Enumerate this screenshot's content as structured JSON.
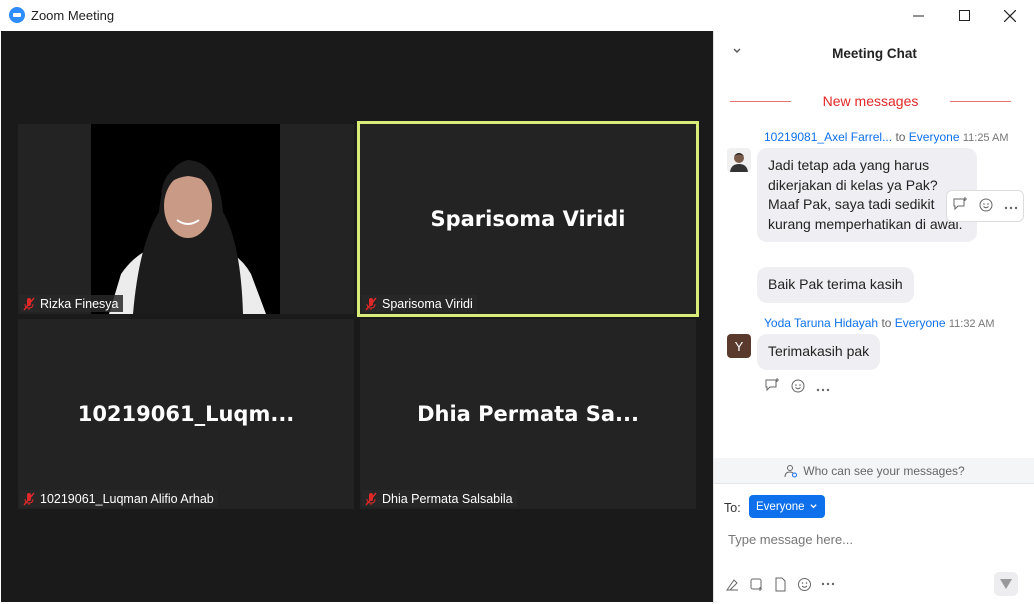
{
  "window": {
    "title": "Zoom Meeting"
  },
  "participants": [
    {
      "display_name": "Rizka Finesya",
      "name_tag": "Rizka Finesya"
    },
    {
      "display_name": "Sparisoma Viridi",
      "name_tag": "Sparisoma Viridi"
    },
    {
      "display_name": "10219061_Luqm...",
      "name_tag": "10219061_Luqman Alifio Arhab"
    },
    {
      "display_name": "Dhia Permata Sa...",
      "name_tag": "Dhia Permata Salsabila"
    }
  ],
  "chat": {
    "title": "Meeting Chat",
    "new_messages": "New messages",
    "messages": [
      {
        "sender": "10219081_Axel Farrel...",
        "to": "to",
        "recipient": "Everyone",
        "time": "11:25 AM",
        "text": "Jadi tetap ada yang harus dikerjakan di kelas ya Pak? Maaf Pak, saya tadi sedikit kurang memperhatikan di awal.",
        "followup": "Baik Pak terima kasih"
      },
      {
        "sender": "Yoda Taruna Hidayah",
        "to": "to",
        "recipient": "Everyone",
        "time": "11:32 AM",
        "avatar_letter": "Y",
        "text": "Terimakasih pak"
      }
    ],
    "visibility_hint": "Who can see your messages?",
    "compose": {
      "to_label": "To:",
      "recipient": "Everyone",
      "placeholder": "Type message here..."
    }
  },
  "colors": {
    "accent": "#0e71eb",
    "active_speaker": "#d9ec7a",
    "new_messages": "#e02828"
  }
}
